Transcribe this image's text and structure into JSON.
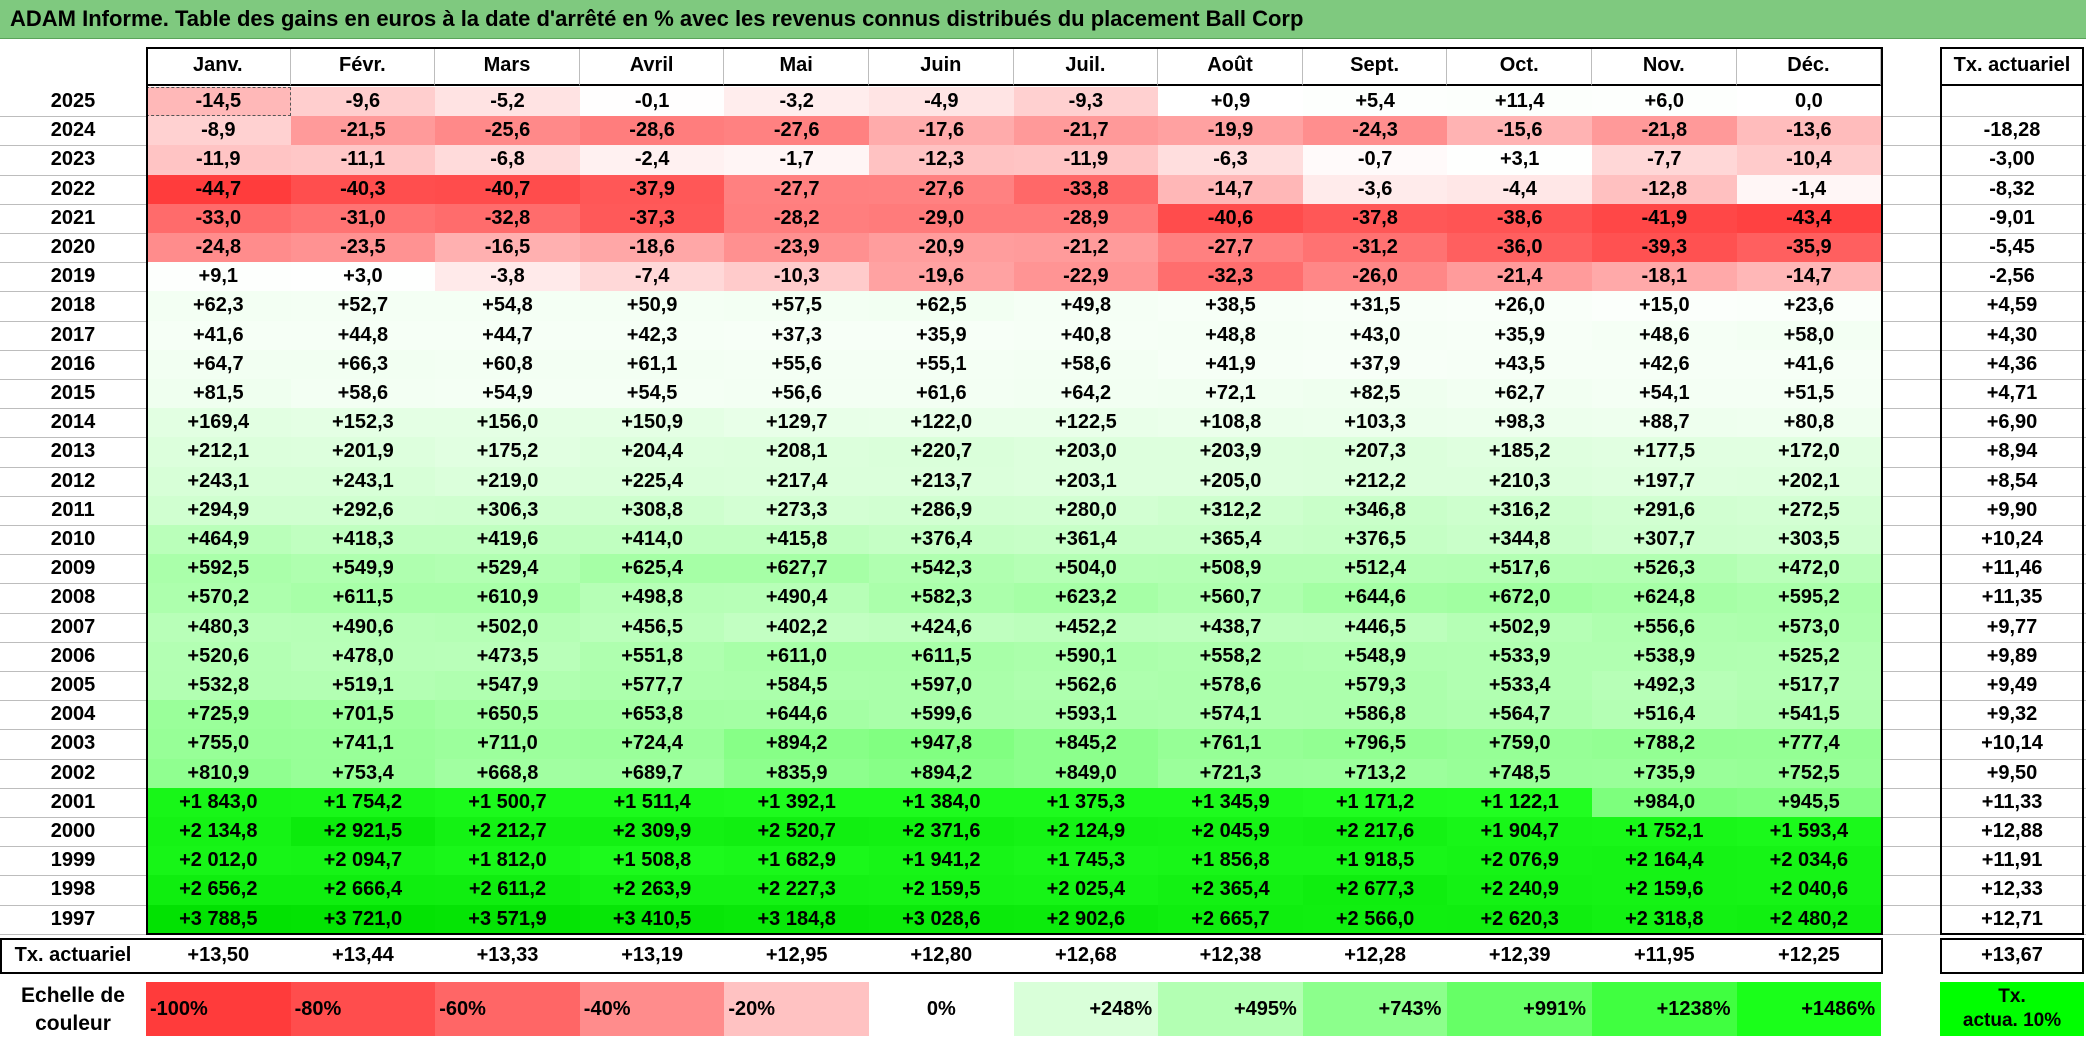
{
  "title": "ADAM Informe. Table des gains en euros à la date d'arrêté en % avec les revenus connus distribués du placement Ball Corp",
  "months": [
    "Janv.",
    "Févr.",
    "Mars",
    "Avril",
    "Mai",
    "Juin",
    "Juil.",
    "Août",
    "Sept.",
    "Oct.",
    "Nov.",
    "Déc."
  ],
  "rate_header": "Tx. actuariel",
  "rows": [
    {
      "year": "2025",
      "values": [
        "-14,5",
        "-9,6",
        "-5,2",
        "-0,1",
        "-3,2",
        "-4,9",
        "-9,3",
        "+0,9",
        "+5,4",
        "+11,4",
        "+6,0",
        "0,0"
      ],
      "rate": ""
    },
    {
      "year": "2024",
      "values": [
        "-8,9",
        "-21,5",
        "-25,6",
        "-28,6",
        "-27,6",
        "-17,6",
        "-21,7",
        "-19,9",
        "-24,3",
        "-15,6",
        "-21,8",
        "-13,6"
      ],
      "rate": "-18,28"
    },
    {
      "year": "2023",
      "values": [
        "-11,9",
        "-11,1",
        "-6,8",
        "-2,4",
        "-1,7",
        "-12,3",
        "-11,9",
        "-6,3",
        "-0,7",
        "+3,1",
        "-7,7",
        "-10,4"
      ],
      "rate": "-3,00"
    },
    {
      "year": "2022",
      "values": [
        "-44,7",
        "-40,3",
        "-40,7",
        "-37,9",
        "-27,7",
        "-27,6",
        "-33,8",
        "-14,7",
        "-3,6",
        "-4,4",
        "-12,8",
        "-1,4"
      ],
      "rate": "-8,32"
    },
    {
      "year": "2021",
      "values": [
        "-33,0",
        "-31,0",
        "-32,8",
        "-37,3",
        "-28,2",
        "-29,0",
        "-28,9",
        "-40,6",
        "-37,8",
        "-38,6",
        "-41,9",
        "-43,4"
      ],
      "rate": "-9,01"
    },
    {
      "year": "2020",
      "values": [
        "-24,8",
        "-23,5",
        "-16,5",
        "-18,6",
        "-23,9",
        "-20,9",
        "-21,2",
        "-27,7",
        "-31,2",
        "-36,0",
        "-39,3",
        "-35,9"
      ],
      "rate": "-5,45"
    },
    {
      "year": "2019",
      "values": [
        "+9,1",
        "+3,0",
        "-3,8",
        "-7,4",
        "-10,3",
        "-19,6",
        "-22,9",
        "-32,3",
        "-26,0",
        "-21,4",
        "-18,1",
        "-14,7"
      ],
      "rate": "-2,56"
    },
    {
      "year": "2018",
      "values": [
        "+62,3",
        "+52,7",
        "+54,8",
        "+50,9",
        "+57,5",
        "+62,5",
        "+49,8",
        "+38,5",
        "+31,5",
        "+26,0",
        "+15,0",
        "+23,6"
      ],
      "rate": "+4,59"
    },
    {
      "year": "2017",
      "values": [
        "+41,6",
        "+44,8",
        "+44,7",
        "+42,3",
        "+37,3",
        "+35,9",
        "+40,8",
        "+48,8",
        "+43,0",
        "+35,9",
        "+48,6",
        "+58,0"
      ],
      "rate": "+4,30"
    },
    {
      "year": "2016",
      "values": [
        "+64,7",
        "+66,3",
        "+60,8",
        "+61,1",
        "+55,6",
        "+55,1",
        "+58,6",
        "+41,9",
        "+37,9",
        "+43,5",
        "+42,6",
        "+41,6"
      ],
      "rate": "+4,36"
    },
    {
      "year": "2015",
      "values": [
        "+81,5",
        "+58,6",
        "+54,9",
        "+54,5",
        "+56,6",
        "+61,6",
        "+64,2",
        "+72,1",
        "+82,5",
        "+62,7",
        "+54,1",
        "+51,5"
      ],
      "rate": "+4,71"
    },
    {
      "year": "2014",
      "values": [
        "+169,4",
        "+152,3",
        "+156,0",
        "+150,9",
        "+129,7",
        "+122,0",
        "+122,5",
        "+108,8",
        "+103,3",
        "+98,3",
        "+88,7",
        "+80,8"
      ],
      "rate": "+6,90"
    },
    {
      "year": "2013",
      "values": [
        "+212,1",
        "+201,9",
        "+175,2",
        "+204,4",
        "+208,1",
        "+220,7",
        "+203,0",
        "+203,9",
        "+207,3",
        "+185,2",
        "+177,5",
        "+172,0"
      ],
      "rate": "+8,94"
    },
    {
      "year": "2012",
      "values": [
        "+243,1",
        "+243,1",
        "+219,0",
        "+225,4",
        "+217,4",
        "+213,7",
        "+203,1",
        "+205,0",
        "+212,2",
        "+210,3",
        "+197,7",
        "+202,1"
      ],
      "rate": "+8,54"
    },
    {
      "year": "2011",
      "values": [
        "+294,9",
        "+292,6",
        "+306,3",
        "+308,8",
        "+273,3",
        "+286,9",
        "+280,0",
        "+312,2",
        "+346,8",
        "+316,2",
        "+291,6",
        "+272,5"
      ],
      "rate": "+9,90"
    },
    {
      "year": "2010",
      "values": [
        "+464,9",
        "+418,3",
        "+419,6",
        "+414,0",
        "+415,8",
        "+376,4",
        "+361,4",
        "+365,4",
        "+376,5",
        "+344,8",
        "+307,7",
        "+303,5"
      ],
      "rate": "+10,24"
    },
    {
      "year": "2009",
      "values": [
        "+592,5",
        "+549,9",
        "+529,4",
        "+625,4",
        "+627,7",
        "+542,3",
        "+504,0",
        "+508,9",
        "+512,4",
        "+517,6",
        "+526,3",
        "+472,0"
      ],
      "rate": "+11,46"
    },
    {
      "year": "2008",
      "values": [
        "+570,2",
        "+611,5",
        "+610,9",
        "+498,8",
        "+490,4",
        "+582,3",
        "+623,2",
        "+560,7",
        "+644,6",
        "+672,0",
        "+624,8",
        "+595,2"
      ],
      "rate": "+11,35"
    },
    {
      "year": "2007",
      "values": [
        "+480,3",
        "+490,6",
        "+502,0",
        "+456,5",
        "+402,2",
        "+424,6",
        "+452,2",
        "+438,7",
        "+446,5",
        "+502,9",
        "+556,6",
        "+573,0"
      ],
      "rate": "+9,77"
    },
    {
      "year": "2006",
      "values": [
        "+520,6",
        "+478,0",
        "+473,5",
        "+551,8",
        "+611,0",
        "+611,5",
        "+590,1",
        "+558,2",
        "+548,9",
        "+533,9",
        "+538,9",
        "+525,2"
      ],
      "rate": "+9,89"
    },
    {
      "year": "2005",
      "values": [
        "+532,8",
        "+519,1",
        "+547,9",
        "+577,7",
        "+584,5",
        "+597,0",
        "+562,6",
        "+578,6",
        "+579,3",
        "+533,4",
        "+492,3",
        "+517,7"
      ],
      "rate": "+9,49"
    },
    {
      "year": "2004",
      "values": [
        "+725,9",
        "+701,5",
        "+650,5",
        "+653,8",
        "+644,6",
        "+599,6",
        "+593,1",
        "+574,1",
        "+586,8",
        "+564,7",
        "+516,4",
        "+541,5"
      ],
      "rate": "+9,32"
    },
    {
      "year": "2003",
      "values": [
        "+755,0",
        "+741,1",
        "+711,0",
        "+724,4",
        "+894,2",
        "+947,8",
        "+845,2",
        "+761,1",
        "+796,5",
        "+759,0",
        "+788,2",
        "+777,4"
      ],
      "rate": "+10,14"
    },
    {
      "year": "2002",
      "values": [
        "+810,9",
        "+753,4",
        "+668,8",
        "+689,7",
        "+835,9",
        "+894,2",
        "+849,0",
        "+721,3",
        "+713,2",
        "+748,5",
        "+735,9",
        "+752,5"
      ],
      "rate": "+9,50"
    },
    {
      "year": "2001",
      "values": [
        "+1 843,0",
        "+1 754,2",
        "+1 500,7",
        "+1 511,4",
        "+1 392,1",
        "+1 384,0",
        "+1 375,3",
        "+1 345,9",
        "+1 171,2",
        "+1 122,1",
        "+984,0",
        "+945,5"
      ],
      "rate": "+11,33"
    },
    {
      "year": "2000",
      "values": [
        "+2 134,8",
        "+2 921,5",
        "+2 212,7",
        "+2 309,9",
        "+2 520,7",
        "+2 371,6",
        "+2 124,9",
        "+2 045,9",
        "+2 217,6",
        "+1 904,7",
        "+1 752,1",
        "+1 593,4"
      ],
      "rate": "+12,88"
    },
    {
      "year": "1999",
      "values": [
        "+2 012,0",
        "+2 094,7",
        "+1 812,0",
        "+1 508,8",
        "+1 682,9",
        "+1 941,2",
        "+1 745,3",
        "+1 856,8",
        "+1 918,5",
        "+2 076,9",
        "+2 164,4",
        "+2 034,6"
      ],
      "rate": "+11,91"
    },
    {
      "year": "1998",
      "values": [
        "+2 656,2",
        "+2 666,4",
        "+2 611,2",
        "+2 263,9",
        "+2 227,3",
        "+2 159,5",
        "+2 025,4",
        "+2 365,4",
        "+2 677,3",
        "+2 240,9",
        "+2 159,6",
        "+2 040,6"
      ],
      "rate": "+12,33"
    },
    {
      "year": "1997",
      "values": [
        "+3 788,5",
        "+3 721,0",
        "+3 571,9",
        "+3 410,5",
        "+3 184,8",
        "+3 028,6",
        "+2 902,6",
        "+2 665,7",
        "+2 566,0",
        "+2 620,3",
        "+2 318,8",
        "+2 480,2"
      ],
      "rate": "+12,71"
    }
  ],
  "summary": {
    "label": "Tx. actuariel",
    "values": [
      "+13,50",
      "+13,44",
      "+13,33",
      "+13,19",
      "+12,95",
      "+12,80",
      "+12,68",
      "+12,38",
      "+12,28",
      "+12,39",
      "+11,95",
      "+12,25"
    ],
    "total": "+13,67"
  },
  "scale": {
    "label_line1": "Echelle de",
    "label_line2": "couleur",
    "steps": [
      {
        "text": "-100%",
        "color": "#ff3b3b",
        "align": "left"
      },
      {
        "text": "-80%",
        "color": "#ff4d4d",
        "align": "left"
      },
      {
        "text": "-60%",
        "color": "#ff6666",
        "align": "left"
      },
      {
        "text": "-40%",
        "color": "#ff8c8c",
        "align": "left"
      },
      {
        "text": "-20%",
        "color": "#ffc2c2",
        "align": "left"
      },
      {
        "text": "0%",
        "color": "#ffffff",
        "align": "center"
      },
      {
        "text": "+248%",
        "color": "#d9ffd9",
        "align": "right"
      },
      {
        "text": "+495%",
        "color": "#b3ffb3",
        "align": "right"
      },
      {
        "text": "+743%",
        "color": "#8cff8c",
        "align": "right"
      },
      {
        "text": "+991%",
        "color": "#66ff66",
        "align": "right"
      },
      {
        "text": "+1238%",
        "color": "#40ff40",
        "align": "right"
      },
      {
        "text": "+1486%",
        "color": "#1aff1a",
        "align": "right"
      }
    ],
    "legend_line1": "Tx.",
    "legend_line2": "actua. 10%"
  },
  "colors": {
    "title_bg": "#7fc97f",
    "negative": "#ff3b3b",
    "positive_max": "#00ff00",
    "legend": "#00ff00"
  }
}
